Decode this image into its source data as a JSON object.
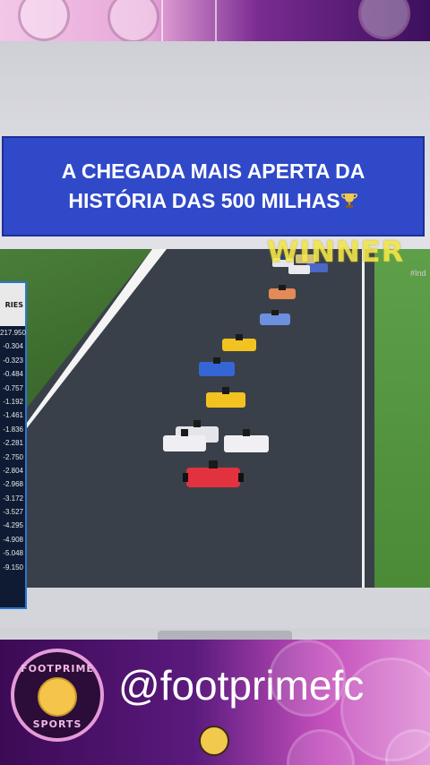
{
  "overlay": {
    "headline": "A CHEGADA MAIS APERTA DA\nHISTÓRIA DAS 500 MILHAS",
    "headline_icon": "trophy-icon",
    "winner_text": "WINNER",
    "hashtag": "#Ind"
  },
  "timing_panel": {
    "header": "RIES",
    "leader": "217.950",
    "gaps": [
      "-0.304",
      "-0.323",
      "-0.484",
      "-0.757",
      "-1.192",
      "-1.461",
      "-1.836",
      "-2.281",
      "-2.750",
      "-2.804",
      "-2.968",
      "-3.172",
      "-3.527",
      "-4.295",
      "-4.908",
      "-5.048",
      "-9.150"
    ]
  },
  "branding": {
    "handle": "@footprimefc",
    "logo_top": "FOOTPRIME",
    "logo_bottom": "SPORTS"
  },
  "colors": {
    "banner_blue": "#2f49c9",
    "winner_yellow": "#f2e64a",
    "footer_purple": "#3c0a55",
    "footer_pink": "#e08fd6"
  }
}
